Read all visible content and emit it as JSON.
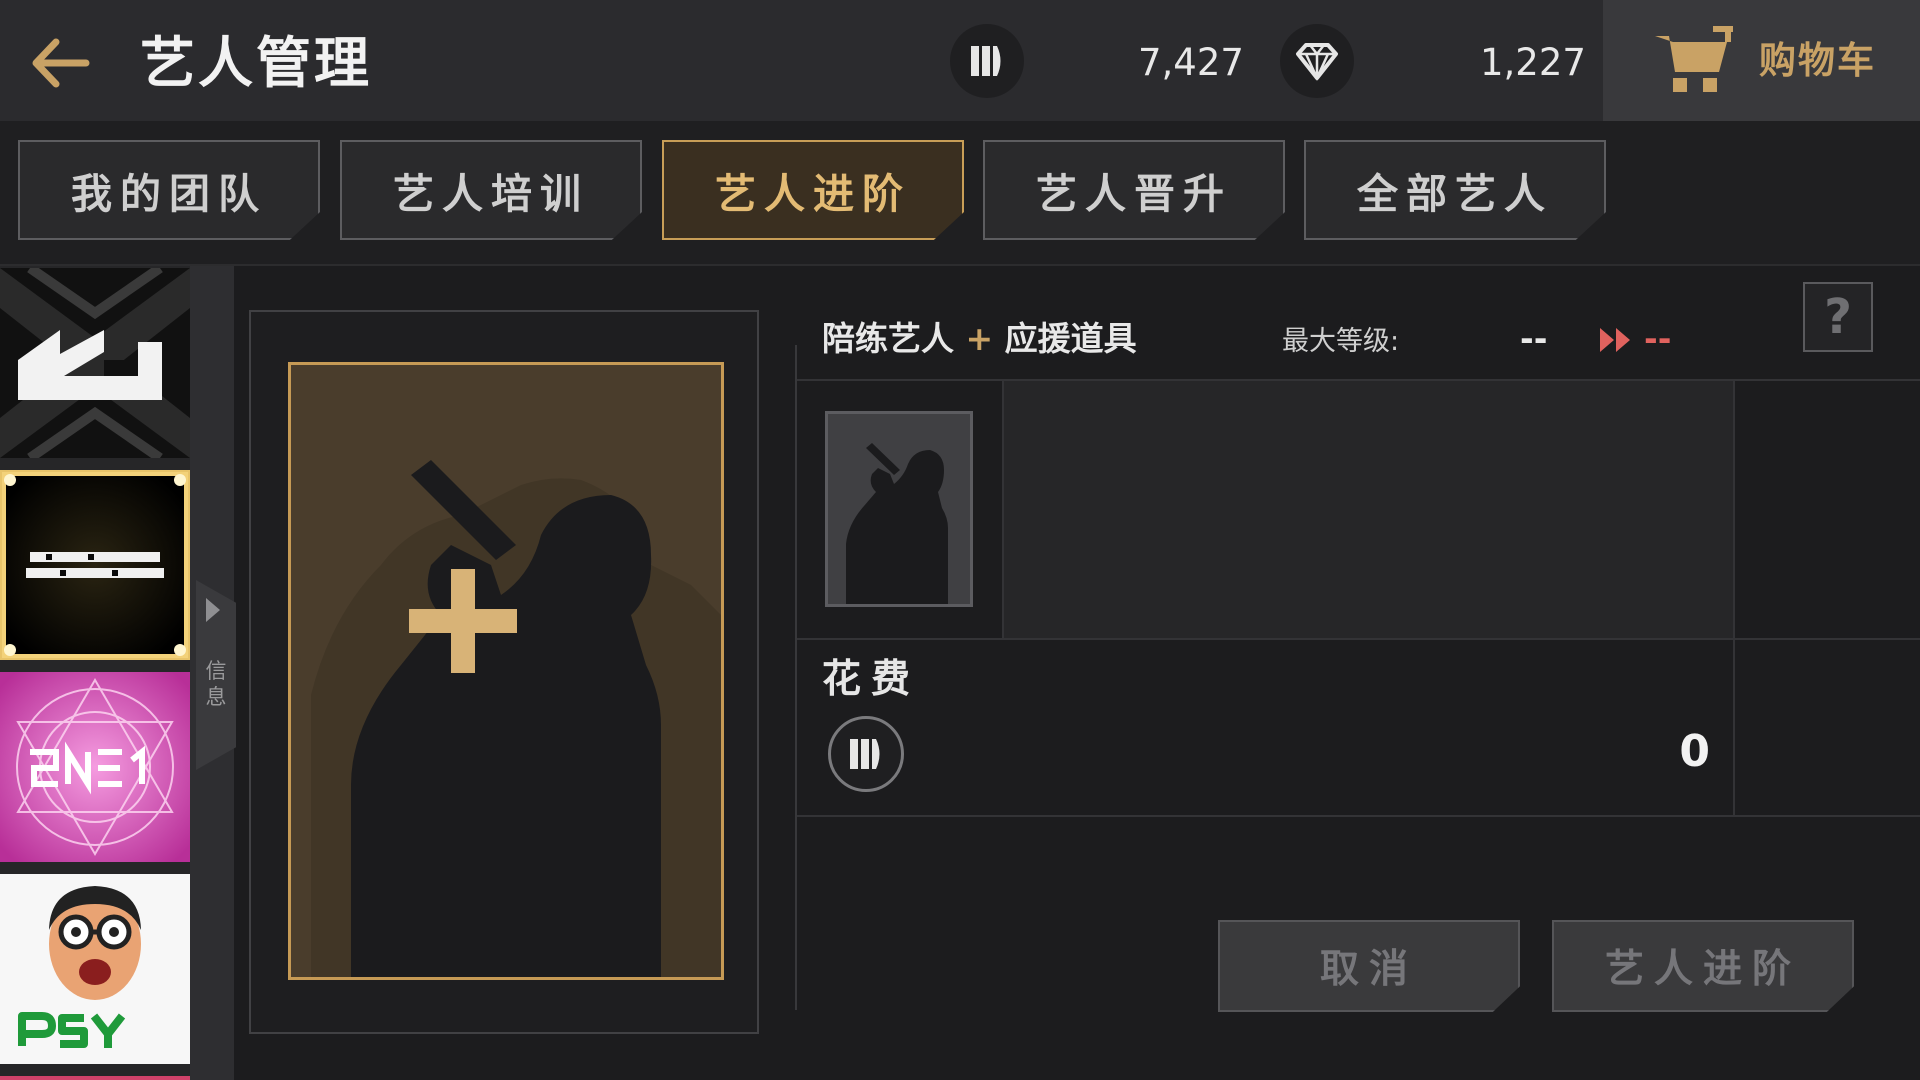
{
  "header": {
    "title": "艺人管理",
    "back_icon": "back-arrow-icon",
    "currency_coin": {
      "icon": "coin-icon",
      "value": "7,427"
    },
    "currency_gem": {
      "icon": "diamond-icon",
      "value": "1,227"
    },
    "cart": {
      "icon": "cart-icon",
      "label": "购物车"
    }
  },
  "tabs": [
    {
      "label": "我的团队",
      "active": false
    },
    {
      "label": "艺人培训",
      "active": false
    },
    {
      "label": "艺人进阶",
      "active": true
    },
    {
      "label": "艺人晋升",
      "active": false
    },
    {
      "label": "全部艺人",
      "active": false
    }
  ],
  "sidebar": {
    "labels": [
      {
        "name": "yg",
        "text": "YG"
      },
      {
        "name": "bigbang",
        "text": "BIG BANG"
      },
      {
        "name": "2ne1",
        "text": "2NE1"
      },
      {
        "name": "psy",
        "text": "PSY"
      }
    ],
    "info_tab_label": "信息"
  },
  "panel": {
    "partner_label": "陪练艺人",
    "plus": "+",
    "support_label": "应援道具",
    "max_level_label": "最大等级:",
    "max_level_current": "--",
    "max_level_next": "--",
    "help": "?",
    "cost_label": "花费",
    "cost_value": "0"
  },
  "buttons": {
    "cancel": "取消",
    "advance": "艺人进阶"
  },
  "colors": {
    "accent_gold": "#c9a265",
    "next_level_red": "#e0625e",
    "background": "#1c1c1e"
  }
}
